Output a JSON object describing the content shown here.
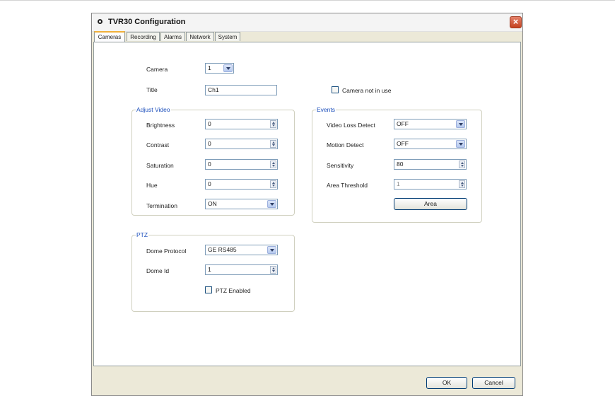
{
  "window": {
    "title": "TVR30 Configuration"
  },
  "tabs": [
    {
      "label": "Cameras",
      "active": true
    },
    {
      "label": "Recording",
      "active": false
    },
    {
      "label": "Alarms",
      "active": false
    },
    {
      "label": "Network",
      "active": false
    },
    {
      "label": "System",
      "active": false
    }
  ],
  "camera": {
    "camera_label": "Camera",
    "camera_value": "1",
    "title_label": "Title",
    "title_value": "Ch1",
    "not_in_use_label": "Camera not in use",
    "not_in_use_checked": false
  },
  "adjust_video": {
    "group_title": "Adjust Video",
    "brightness_label": "Brightness",
    "brightness_value": "0",
    "contrast_label": "Contrast",
    "contrast_value": "0",
    "saturation_label": "Saturation",
    "saturation_value": "0",
    "hue_label": "Hue",
    "hue_value": "0",
    "termination_label": "Termination",
    "termination_value": "ON"
  },
  "events": {
    "group_title": "Events",
    "video_loss_label": "Video Loss Detect",
    "video_loss_value": "OFF",
    "motion_label": "Motion Detect",
    "motion_value": "OFF",
    "sensitivity_label": "Sensitivity",
    "sensitivity_value": "80",
    "area_threshold_label": "Area Threshold",
    "area_threshold_value": "1",
    "area_button": "Area"
  },
  "ptz": {
    "group_title": "PTZ",
    "protocol_label": "Dome Protocol",
    "protocol_value": "GE RS485",
    "dome_id_label": "Dome Id",
    "dome_id_value": "1",
    "enabled_label": "PTZ Enabled",
    "enabled_checked": false
  },
  "footer": {
    "ok": "OK",
    "cancel": "Cancel"
  },
  "colors": {
    "group_title": "#1a4dbb",
    "close_button": "#d5553a",
    "active_tab_accent": "#f1b03a"
  }
}
